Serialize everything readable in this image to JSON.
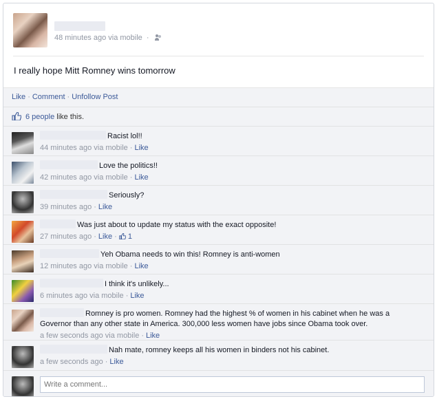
{
  "post": {
    "time": "48 minutes ago",
    "via": "via mobile",
    "text": "I really hope Mitt Romney wins tomorrow"
  },
  "actions": {
    "like": "Like",
    "comment": "Comment",
    "unfollow": "Unfollow Post"
  },
  "likes": {
    "count_text": "6 people",
    "suffix": "like this."
  },
  "comments": [
    {
      "text": "Racist lol!!",
      "time": "44 minutes ago via mobile",
      "like": "Like"
    },
    {
      "text": "Love the politics!!",
      "time": "42 minutes ago via mobile",
      "like": "Like"
    },
    {
      "text": "Seriously?",
      "time": "39 minutes ago",
      "like": "Like"
    },
    {
      "text": "Was just about to update my status with the exact opposite!",
      "time": "27 minutes ago",
      "like": "Like",
      "likes": "1"
    },
    {
      "text": "Yeh Obama needs to win this! Romney is anti-women",
      "time": "12 minutes ago via mobile",
      "like": "Like"
    },
    {
      "text": "I think it's unlikely...",
      "time": "6 minutes ago via mobile",
      "like": "Like"
    },
    {
      "text": "Romney is pro women. Romney had the highest % of women in his cabinet when he was a Governor than any other state in America. 300,000 less women have jobs since Obama took over.",
      "time": "a few seconds ago via mobile",
      "like": "Like"
    },
    {
      "text": "Nah mate, romney keeps all his women in binders not his cabinet.",
      "time": "a few seconds ago",
      "like": "Like"
    }
  ],
  "composer": {
    "placeholder": "Write a comment..."
  },
  "icons": {
    "like": "thumbs-up-icon",
    "audience": "friends-icon"
  },
  "colors": {
    "link": "#3b5998",
    "meta": "#9197a3",
    "panel": "#f2f3f6"
  }
}
